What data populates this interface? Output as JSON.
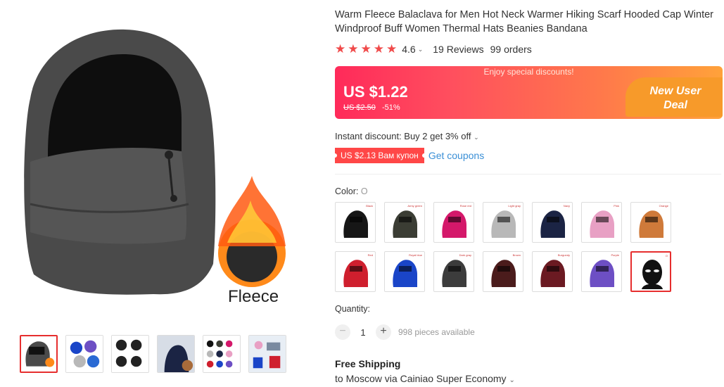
{
  "product": {
    "title": "Warm Fleece Balaclava for Men Hot Neck Warmer Hiking Scarf Hooded Cap Winter Windproof Buff Women Thermal Hats Beanies Bandana",
    "rating": "4.6",
    "rating_chevron": "⌄",
    "reviews": "19 Reviews",
    "orders": "99 orders",
    "stars": [
      "★",
      "★",
      "★",
      "★",
      "★"
    ]
  },
  "gallery": {
    "fleece_label": "Fleece",
    "thumbs": [
      "thumb-1",
      "thumb-2",
      "thumb-3",
      "thumb-4",
      "thumb-5",
      "thumb-6"
    ]
  },
  "price": {
    "banner_text": "Enjoy special discounts!",
    "current": "US $1.22",
    "old": "US $2.50",
    "discount": "-51%",
    "deal_line1": "New User",
    "deal_line2": "Deal"
  },
  "promo": {
    "instant": "Instant discount: Buy 2 get 3% off",
    "coupon_tag": "US $2.13 Вам купон",
    "get_coupons": "Get coupons"
  },
  "color": {
    "label": "Color:",
    "selected": "O",
    "options": [
      {
        "label": "Black",
        "hex": "#161616"
      },
      {
        "label": "Army green",
        "hex": "#3b3d34"
      },
      {
        "label": "Rose red",
        "hex": "#d4186a"
      },
      {
        "label": "Light gray",
        "hex": "#b8b8b8"
      },
      {
        "label": "Navy",
        "hex": "#1b2444"
      },
      {
        "label": "Pink",
        "hex": "#e8a0c4"
      },
      {
        "label": "Orange",
        "hex": "#cf7a3a"
      },
      {
        "label": "Red",
        "hex": "#cf1f2e"
      },
      {
        "label": "Royal blue",
        "hex": "#1a45c8"
      },
      {
        "label": "Dark gray",
        "hex": "#3c3c3c"
      },
      {
        "label": "Brown",
        "hex": "#4b1c1c"
      },
      {
        "label": "Burgundy",
        "hex": "#6b1a22"
      },
      {
        "label": "Purple",
        "hex": "#6d4fc4"
      },
      {
        "label": "O",
        "hex": "#111111"
      }
    ]
  },
  "quantity": {
    "label": "Quantity:",
    "minus": "−",
    "plus": "+",
    "value": "1",
    "available": "998 pieces available"
  },
  "shipping": {
    "title": "Free Shipping",
    "detail": "to Moscow via Cainiao Super Economy",
    "chevron": "⌄"
  },
  "colors": {
    "accent_red": "#e62e2e",
    "star": "#f04a4a",
    "link": "#3a8fd6",
    "deal_orange": "#f79a2a"
  }
}
